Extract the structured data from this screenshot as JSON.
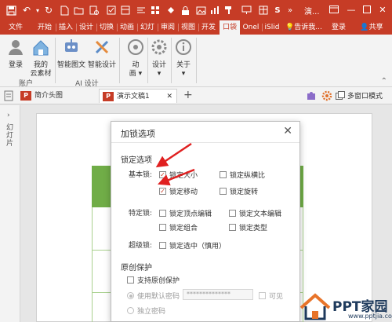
{
  "titlebar": {
    "title": "演...",
    "user_initial": "S",
    "colors": {
      "brand": "#c63c26",
      "ribbon_bg": "#f3f3f3",
      "slide_green": "#70ad47"
    }
  },
  "tabs": [
    {
      "label": "文件",
      "active": false
    },
    {
      "label": "开始",
      "active": false
    },
    {
      "label": "插入",
      "active": false
    },
    {
      "label": "设计",
      "active": false
    },
    {
      "label": "切换",
      "active": false
    },
    {
      "label": "动画",
      "active": false
    },
    {
      "label": "幻灯",
      "active": false
    },
    {
      "label": "审阅",
      "active": false
    },
    {
      "label": "视图",
      "active": false
    },
    {
      "label": "开发",
      "active": false
    },
    {
      "label": "口袋",
      "active": true
    },
    {
      "label": "Onel",
      "active": false
    },
    {
      "label": "iSlid",
      "active": false
    },
    {
      "label": "告诉我...",
      "active": false
    },
    {
      "label": "登录",
      "active": false
    },
    {
      "label": "共享",
      "active": false
    }
  ],
  "ribbon": {
    "login": "登录",
    "my_material": [
      "我的",
      "云素材"
    ],
    "group_account": "账户",
    "smart_graphic": "智能图文",
    "smart_design": "智能设计",
    "group_ai": "AI 设计",
    "animation": "动\n画",
    "design": "设计",
    "about": "关于",
    "multiwindow": "多窗口模式"
  },
  "doctabs": [
    {
      "label": "简介头图",
      "active": false
    },
    {
      "label": "演示文稿1",
      "active": true
    }
  ],
  "leftpanel": {
    "label": "幻灯片"
  },
  "dialog": {
    "title": "加锁选项",
    "section_lock": "锁定选项",
    "basic_label": "基本锁:",
    "special_label": "特定锁:",
    "super_label": "超级锁:",
    "options": {
      "lock_size": {
        "label": "锁定大小",
        "checked": true
      },
      "lock_ratio": {
        "label": "锁定纵横比",
        "checked": false
      },
      "lock_move": {
        "label": "锁定移动",
        "checked": true
      },
      "lock_rotate": {
        "label": "锁定旋转",
        "checked": false
      },
      "lock_vertex": {
        "label": "锁定顶点编辑",
        "checked": false
      },
      "lock_text": {
        "label": "锁定文本编辑",
        "checked": false
      },
      "lock_group": {
        "label": "锁定组合",
        "checked": false
      },
      "lock_type": {
        "label": "锁定类型",
        "checked": false
      },
      "lock_select": {
        "label": "锁定选中（慎用）",
        "checked": false
      }
    },
    "section_original": "原创保护",
    "support_original": "支持原创保护",
    "use_default_pwd": "使用默认密码",
    "pwd_value": "**************",
    "visible": "可见",
    "separate_pwd": "独立密码"
  },
  "watermark": {
    "text": "PPT家园",
    "url": "www.pptjia.com"
  }
}
